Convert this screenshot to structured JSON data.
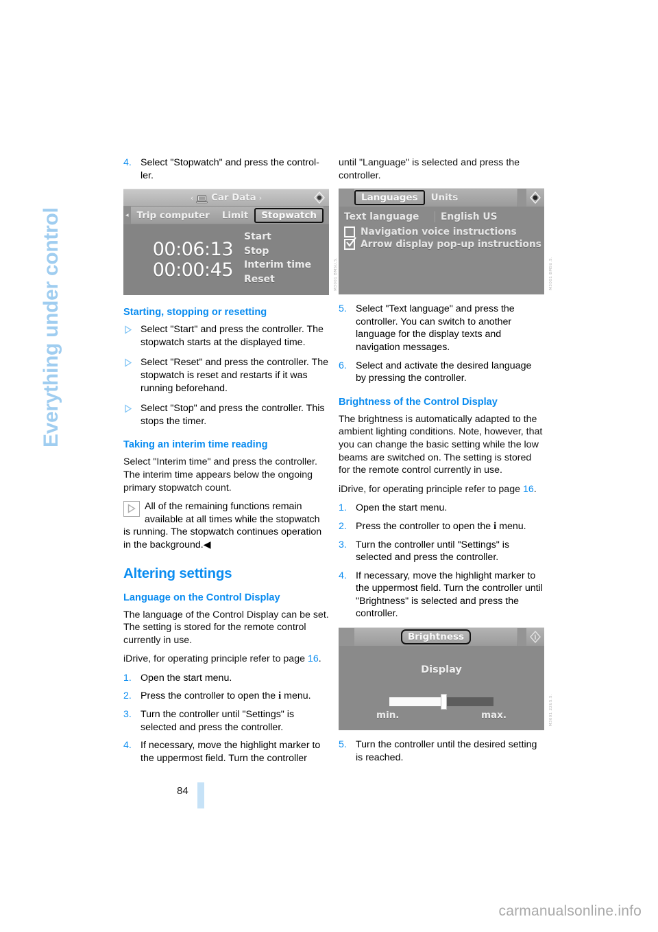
{
  "chapter_tab": {
    "label": "Everything under control"
  },
  "page": {
    "number": "84",
    "watermark": "carmanualsonline.info"
  },
  "left_column": {
    "step4": {
      "num": "4.",
      "text": "Select \"Stopwatch\" and press the control-ler."
    },
    "stopwatch_shot": {
      "ref_code": "M3001 BMSU.S.",
      "top_bar": {
        "arrow_left": "‹",
        "title": "Car Data",
        "arrow_right": "›",
        "laptop_icon": "laptop-icon",
        "knob_icon": "joystick-icon"
      },
      "tab_bar": {
        "back_arrow": "◂",
        "tabs": [
          "Trip computer",
          "Limit",
          "Stopwatch"
        ],
        "selected": "Stopwatch"
      },
      "times": [
        "00:06:13",
        "00:00:45"
      ],
      "menu": [
        "Start",
        "Stop",
        "Interim time",
        "Reset"
      ]
    },
    "heading_starting": "Starting, stopping or resetting",
    "bullets": [
      "Select \"Start\" and press the controller. The stopwatch starts at the displayed time.",
      "Select \"Reset\" and press the controller. The stopwatch is reset and restarts if it was running beforehand.",
      "Select \"Stop\" and press the controller. This stops the timer."
    ],
    "heading_interim": "Taking an interim time reading",
    "interim_para": "Select \"Interim time\" and press the controller. The interim time appears below the ongoing primary stopwatch count.",
    "note": {
      "lead": "All of the remaining functions remain available at all times while the stopwatch",
      "rest": "is running. The stopwatch continues operation in the background.",
      "end_mark": "◀"
    },
    "heading_altering": "Altering settings",
    "heading_language": "Language on the Control Display",
    "language_para": "The language of the Control Display can be set. The setting is stored for the remote control currently in use.",
    "idrive_line": {
      "pre": "iDrive, for operating principle refer to page",
      "page": "16",
      "post": "."
    },
    "steps": [
      {
        "num": "1.",
        "text": "Open the start menu."
      },
      {
        "num": "2.",
        "pre": "Press the controller to open the",
        "symbol": "i",
        "post": "menu."
      },
      {
        "num": "3.",
        "text": "Turn the controller until \"Settings\" is selected and press the controller."
      },
      {
        "num": "4.",
        "text": "If necessary, move the highlight marker to the uppermost field. Turn the controller"
      }
    ]
  },
  "right_column": {
    "step4_continued": "until \"Language\" is selected and press the controller.",
    "languages_shot": {
      "ref_code": "M3001 BMSU.S.",
      "tab_bar": {
        "tabs": [
          "Languages",
          "Units"
        ],
        "selected": "Languages",
        "knob_icon": "joystick-icon"
      },
      "row": {
        "label": "Text language",
        "value": "English US"
      },
      "checkboxes": [
        {
          "label": "Navigation voice instructions",
          "checked": false
        },
        {
          "label": "Arrow display pop-up instructions",
          "checked": true
        }
      ]
    },
    "steps": [
      {
        "num": "5.",
        "text": "Select \"Text language\" and press the controller. You can switch to another language for the display texts and navigation messages."
      },
      {
        "num": "6.",
        "text": "Select and activate the desired language by pressing the controller."
      }
    ],
    "heading_brightness": "Brightness of the Control Display",
    "brightness_para": "The brightness is automatically adapted to the ambient lighting conditions. Note, however, that you can change the basic setting while the low beams are switched on. The setting is stored for the remote control currently in use.",
    "idrive_line": {
      "pre": "iDrive, for operating principle refer to page",
      "page": "16",
      "post": "."
    },
    "steps2": [
      {
        "num": "1.",
        "text": "Open the start menu."
      },
      {
        "num": "2.",
        "pre": "Press the controller to open the",
        "symbol": "i",
        "post": "menu."
      },
      {
        "num": "3.",
        "text": "Turn the controller until \"Settings\" is selected and press the controller."
      },
      {
        "num": "4.",
        "text": "If necessary, move the highlight marker to the uppermost field. Turn the controller until \"Brightness\" is selected and press the controller."
      }
    ],
    "brightness_shot": {
      "ref_code": "M3001 22US.S.",
      "tab_bar": {
        "title": "Brightness",
        "info_icon": "info-icon"
      },
      "display_label": "Display",
      "min_label": "min.",
      "max_label": "max.",
      "value_percent": 52
    },
    "step5": {
      "num": "5.",
      "text": "Turn the controller until the desired setting is reached."
    }
  },
  "colors": {
    "accent_blue": "#0a8cf0",
    "tab_blue": "#9fcdf0",
    "page_bar": "#c6e2f7"
  }
}
